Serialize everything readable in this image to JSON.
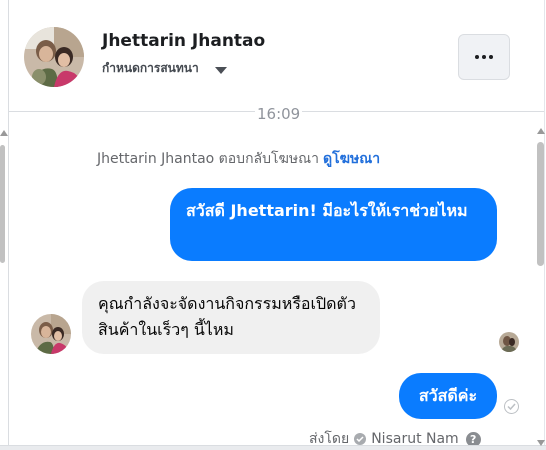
{
  "header": {
    "contact_name": "Jhettarin Jhantao",
    "status_label": "กำหนดการสนทนา"
  },
  "conversation": {
    "timestamp": "16:09",
    "ad_reply": {
      "text": "Jhettarin Jhantao ตอบกลับโฆษณา",
      "link_label": "ดูโฆษณา"
    },
    "messages": [
      {
        "direction": "outgoing",
        "text": "สวัสดี Jhettarin! มีอะไรให้เราช่วยไหม"
      },
      {
        "direction": "incoming",
        "text": "คุณกำลังจะจัดงานกิจกรรมหรือเปิดตัวสินค้าในเร็วๆ นี้ไหม"
      },
      {
        "direction": "outgoing",
        "text": "สวัสดีค่ะ"
      }
    ],
    "sent_by": {
      "label": "ส่งโดย",
      "name": "Nisarut Nam"
    }
  },
  "icons": {
    "more": "more-dots-icon",
    "caret": "caret-down-icon",
    "sent": "sent-check-icon",
    "help": "help-icon"
  },
  "colors": {
    "outgoing_bubble": "#0a7cff",
    "incoming_bubble": "#f0f0f0",
    "link": "#216fdb"
  }
}
